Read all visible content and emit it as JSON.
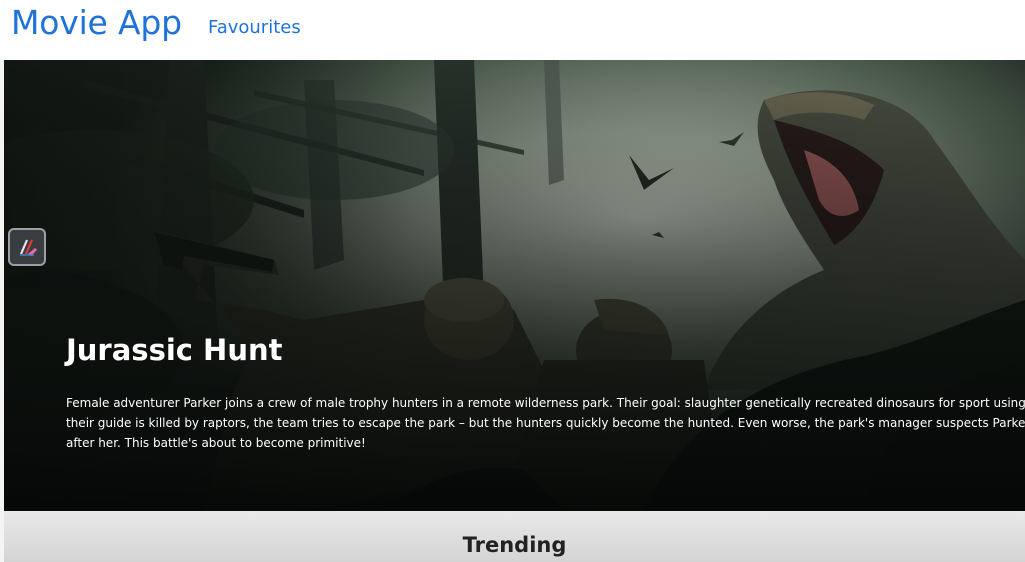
{
  "navbar": {
    "brand": "Movie App",
    "links": [
      "Favourites"
    ]
  },
  "hero": {
    "title": "Jurassic Hunt",
    "description_lines": [
      "Female adventurer Parker joins a crew of male trophy hunters in a remote wilderness park. Their goal: slaughter genetically recreated dinosaurs for sport using rifles, arrows",
      "their guide is killed by raptors, the team tries to escape the park – but the hunters quickly become the hunted. Even worse, the park's manager suspects Parker of being a sp",
      "after her. This battle's about to become primitive!"
    ]
  },
  "extension": {
    "icon": "pen-extension-icon"
  },
  "sections": {
    "trending_title": "Trending"
  },
  "colors": {
    "brand": "#1f72d8",
    "hero_text": "#ffffff",
    "trending_bg": "#dedede"
  }
}
